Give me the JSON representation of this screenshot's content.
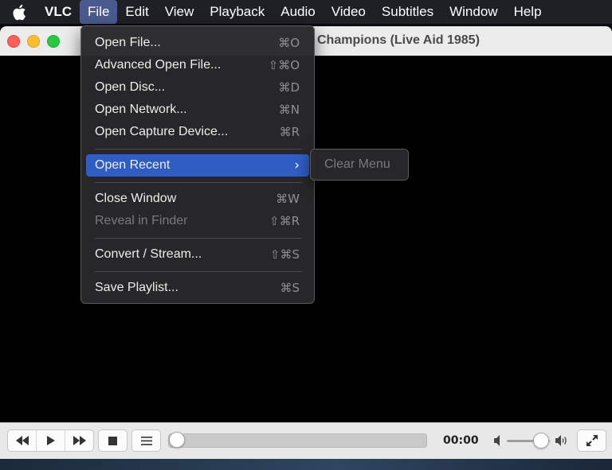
{
  "menubar": {
    "apple_icon": "apple-logo-icon",
    "app_name": "VLC",
    "items": [
      "File",
      "Edit",
      "View",
      "Playback",
      "Audio",
      "Video",
      "Subtitles",
      "Window",
      "Help"
    ]
  },
  "window": {
    "title": "Champions (Live Aid 1985)"
  },
  "file_menu": {
    "items": [
      {
        "label": "Open File...",
        "shortcut": "⌘O"
      },
      {
        "label": "Advanced Open File...",
        "shortcut": "⇧⌘O"
      },
      {
        "label": "Open Disc...",
        "shortcut": "⌘D"
      },
      {
        "label": "Open Network...",
        "shortcut": "⌘N"
      },
      {
        "label": "Open Capture Device...",
        "shortcut": "⌘R"
      },
      {
        "label": "Open Recent",
        "shortcut": "›"
      },
      {
        "label": "Close Window",
        "shortcut": "⌘W"
      },
      {
        "label": "Reveal in Finder",
        "shortcut": "⇧⌘R"
      },
      {
        "label": "Convert / Stream...",
        "shortcut": "⇧⌘S"
      },
      {
        "label": "Save Playlist...",
        "shortcut": "⌘S"
      }
    ],
    "submenu": {
      "label": "Clear Menu"
    }
  },
  "controls": {
    "time": "00:00",
    "progress_fraction": 0.0,
    "volume_fraction": 0.75
  },
  "colors": {
    "highlight": "#2f5dc4",
    "menu_bg": "#28282a",
    "menubar_active": "#4a5a8e"
  }
}
